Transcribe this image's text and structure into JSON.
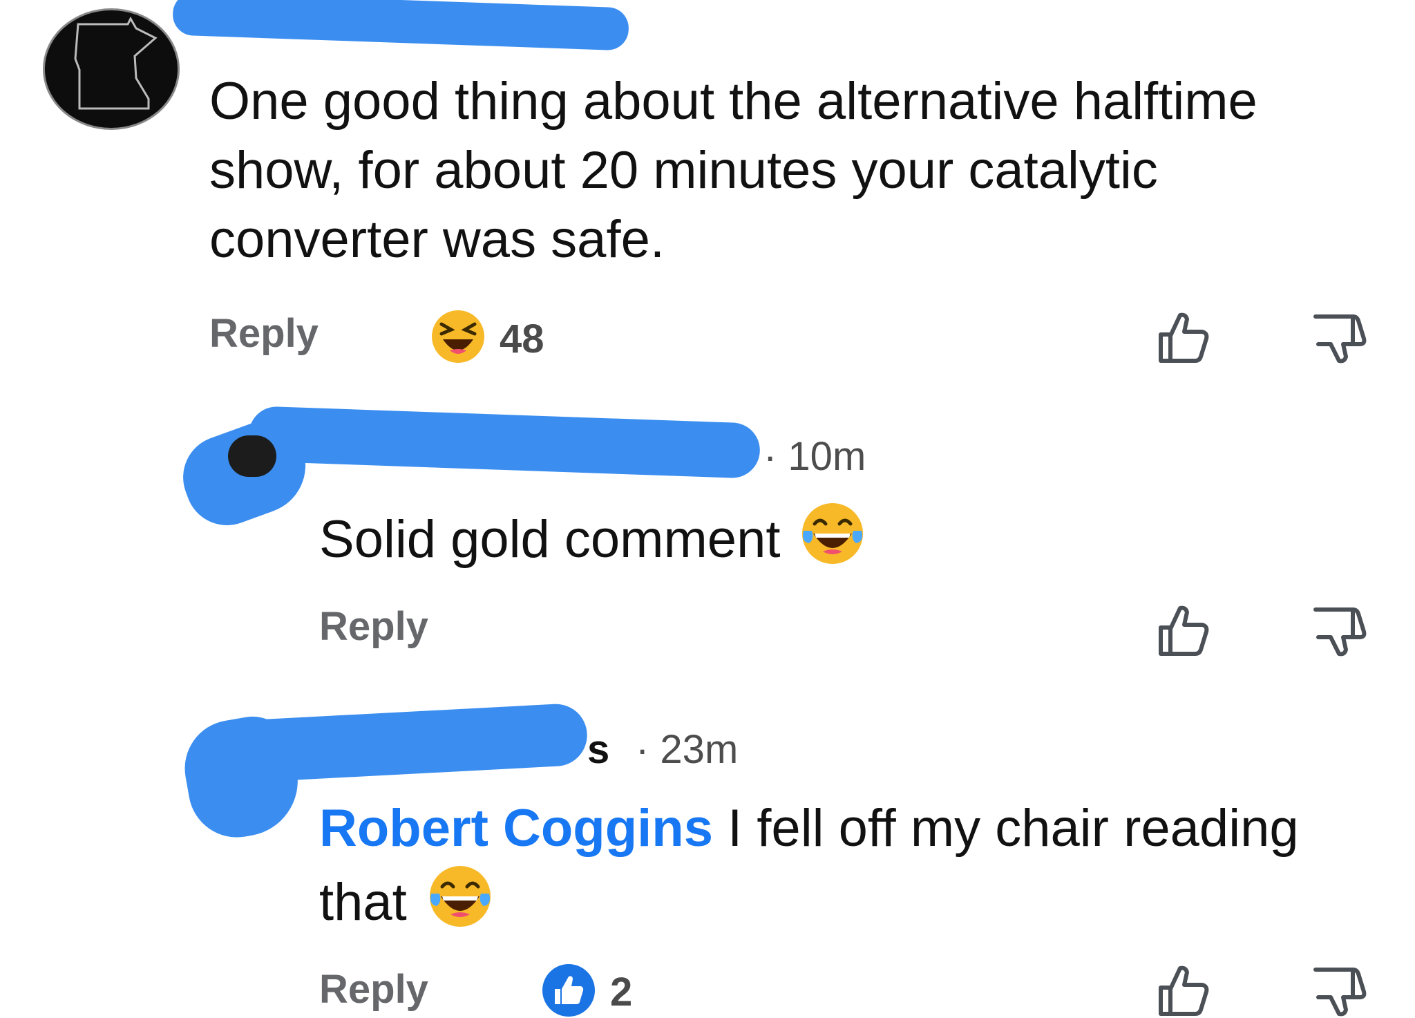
{
  "comment": {
    "text": "One good thing about the alternative halftime show, for about 20 minutes your catalytic converter was safe.",
    "reply_label": "Reply",
    "reaction_count": "48"
  },
  "reply1": {
    "time": "· 10m",
    "text": "Solid gold comment",
    "reply_label": "Reply"
  },
  "reply2": {
    "name_tail": "s",
    "time": "· 23m",
    "mention": "Robert Coggins",
    "text": " I fell off my chair reading that",
    "reply_label": "Reply",
    "reaction_count": "2"
  },
  "colors": {
    "link_blue": "#1877f2",
    "redaction_blue": "#3b8ef0",
    "muted_gray": "#65676b"
  },
  "icons": [
    "minnesota-outline-avatar",
    "laughing-squint-emoji",
    "tears-of-joy-emoji",
    "like-badge-icon",
    "thumbs-up-icon",
    "thumbs-down-icon"
  ]
}
